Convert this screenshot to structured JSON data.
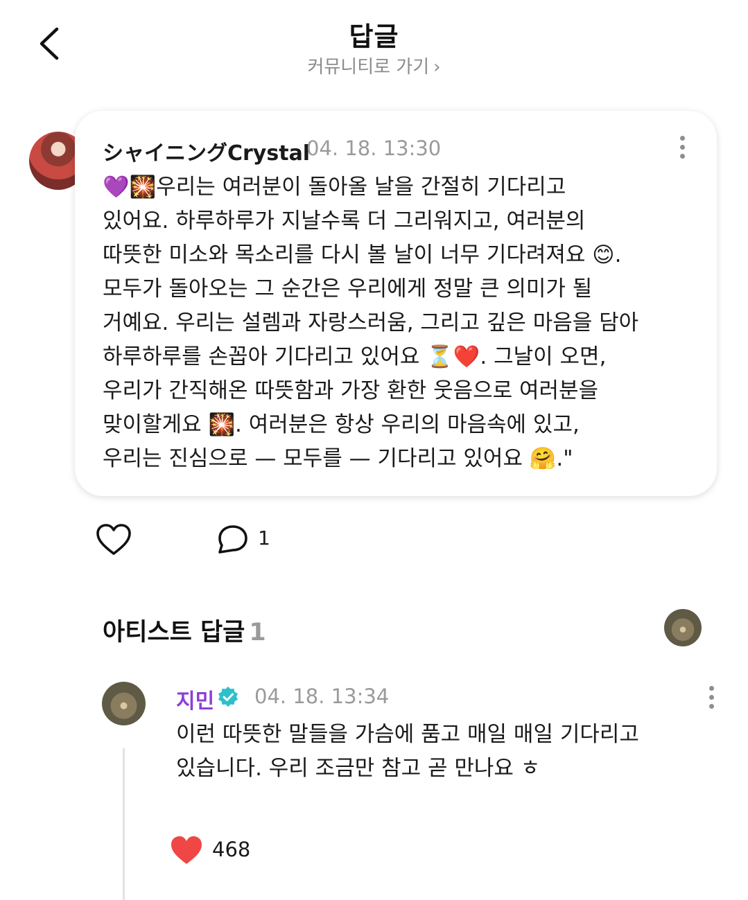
{
  "header": {
    "title": "답글",
    "community_link": "커뮤니티로 가기",
    "back_icon": "chevron-left-icon"
  },
  "post": {
    "author": "シャイニングCrystal",
    "timestamp": "04. 18. 13:30",
    "text": "💜🎇우리는 여러분이 돌아올 날을 간절히 기다리고\n있어요. 하루하루가 지날수록 더 그리워지고, 여러분의\n따뜻한 미소와 목소리를 다시 볼 날이 너무 기다려져요 😊.\n모두가 돌아오는 그 순간은 우리에게 정말 큰 의미가 될\n거예요. 우리는 설렘과 자랑스러움, 그리고 깊은 마음을 담아\n하루하루를 손꼽아 기다리고 있어요 ⏳❤️. 그날이 오면,\n우리가 간직해온 따뜻함과 가장 환한 웃음으로 여러분을\n맞이할게요 🎇. 여러분은 항상 우리의 마음속에 있고,\n우리는 진심으로 — 모두를 — 기다리고 있어요 🤗.\"",
    "comment_count": "1"
  },
  "artist_replies": {
    "title": "아티스트 답글",
    "count": "1"
  },
  "reply": {
    "author": "지민",
    "timestamp": "04. 18. 13:34",
    "text": "이런 따뜻한 말들을 가슴에 품고 매일 매일 기다리고\n있습니다. 우리 조금만 참고 곧 만나요 ㅎ",
    "like_count": "468"
  },
  "colors": {
    "artist_name": "#8d3fd6",
    "verified_badge": "#2fbfc9",
    "liked_heart": "#f04646",
    "muted_text": "#9a9a9a"
  }
}
